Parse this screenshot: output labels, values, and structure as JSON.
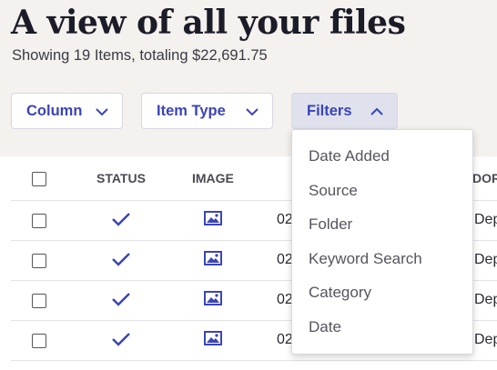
{
  "page": {
    "title": "A view of all your files",
    "subtitle": "Showing 19 Items, totaling $22,691.75"
  },
  "toolbar": {
    "column_label": "Column",
    "item_type_label": "Item Type",
    "filters_label": "Filters"
  },
  "filters_menu": {
    "options": [
      "Date Added",
      "Source",
      "Folder",
      "Keyword Search",
      "Category",
      "Date"
    ]
  },
  "table": {
    "headers": {
      "status": "STATUS",
      "image": "IMAGE",
      "partial_right": "DOR"
    },
    "rows": [
      {
        "date_partial": "02",
        "right_partial": "Dep"
      },
      {
        "date_partial": "02",
        "right_partial": "Dep"
      },
      {
        "date_partial": "02",
        "right_partial": "Dep"
      },
      {
        "date_partial": "02",
        "right_partial": "Dep"
      }
    ]
  },
  "icons": {
    "checkbox": "checkbox-icon",
    "status": "checkmark-icon",
    "image": "image-icon",
    "chevron_down": "chevron-down-icon",
    "chevron_up": "chevron-up-icon"
  },
  "colors": {
    "accent": "#3b44b8",
    "header_bg": "#f4f1ee",
    "active_button_bg": "#dfe1ec",
    "title": "#1c1c28"
  }
}
